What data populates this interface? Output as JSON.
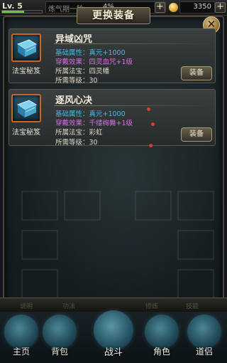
{
  "topbar": {
    "level": "Lv. 5",
    "level_progress": 0.55,
    "cultivation_label": "炼气期一阶",
    "cultivation_percent": "4%",
    "gold": "3350"
  },
  "panel": {
    "title": "更换装备",
    "close_symbol": "✕"
  },
  "items": [
    {
      "name": "异域凶咒",
      "type": "法宝秘笈",
      "base_attr": "基础属性：真元+1000",
      "wear_effect": "穿戴效果：四灵血咒+1级",
      "belongs": "所属法宝：四灵幡",
      "required_level": "所需等级：30",
      "equip_label": "装备"
    },
    {
      "name": "逐风心决",
      "type": "法宝秘笈",
      "base_attr": "基础属性：真元+1000",
      "wear_effect": "穿戴效果：千缕绚舞+1级",
      "belongs": "所属法宝：彩虹",
      "required_level": "所需等级：30",
      "equip_label": "装备"
    }
  ],
  "bottom_strip": [
    "说明",
    "功法",
    "",
    "修炼",
    "技能"
  ],
  "nav": [
    {
      "label": "主页",
      "icon": "home-icon"
    },
    {
      "label": "背包",
      "icon": "bag-icon"
    },
    {
      "label": "战斗",
      "icon": "battle-icon"
    },
    {
      "label": "角色",
      "icon": "character-icon"
    },
    {
      "label": "道侣",
      "icon": "companion-icon"
    }
  ],
  "colors": {
    "attr_blue": "#4ab8e6",
    "attr_purple": "#d86ee6",
    "icon_border": "#c2692a",
    "notification_dot": "#e23a2a"
  }
}
